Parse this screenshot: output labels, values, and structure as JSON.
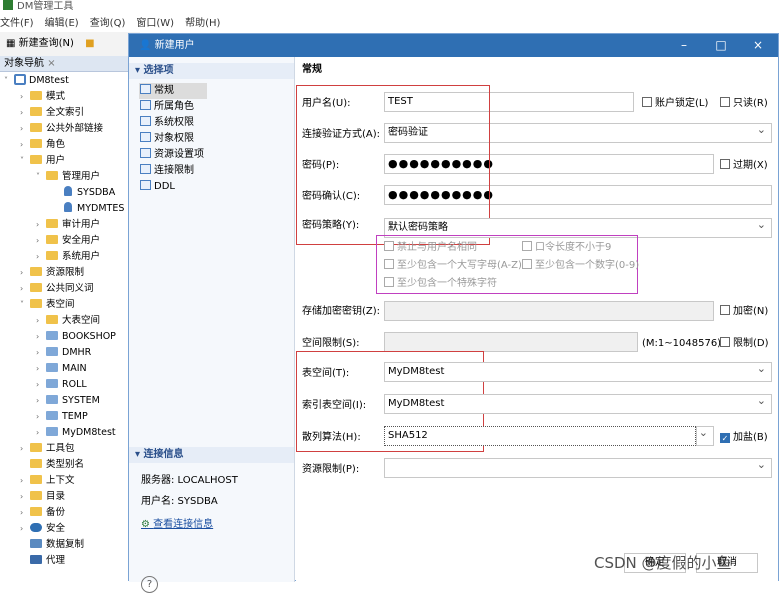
{
  "app": {
    "title": "DM管理工具"
  },
  "menu": [
    "文件(F)",
    "编辑(E)",
    "查询(Q)",
    "窗口(W)",
    "帮助(H)"
  ],
  "toolbar": {
    "new_query": "新建查询(N)"
  },
  "nav": {
    "title": "对象导航",
    "items": [
      "DM8test",
      "模式",
      "全文索引",
      "公共外部链接",
      "角色",
      "用户",
      "管理用户",
      "SYSDBA",
      "MYDMTES",
      "审计用户",
      "安全用户",
      "系统用户",
      "资源限制",
      "公共同义词",
      "表空间",
      "大表空间",
      "BOOKSHOP",
      "DMHR",
      "MAIN",
      "ROLL",
      "SYSTEM",
      "TEMP",
      "MyDM8test",
      "工具包",
      "类型别名",
      "上下文",
      "目录",
      "备份",
      "安全",
      "数据复制",
      "代理"
    ]
  },
  "dialog": {
    "title": "新建用户",
    "select_section": "选择项",
    "pages": [
      "常规",
      "所属角色",
      "系统权限",
      "对象权限",
      "资源设置项",
      "连接限制",
      "DDL"
    ],
    "conn_section": "连接信息",
    "server": "服务器: LOCALHOST",
    "user": "用户名: SYSDBA",
    "view_conn": "查看连接信息",
    "section": "常规",
    "labels": {
      "username": "用户名(U):",
      "auth": "连接验证方式(A):",
      "password": "密码(P):",
      "confirm": "密码确认(C):",
      "policy": "密码策略(Y):",
      "storekey": "存储加密密钥(Z):",
      "space": "空间限制(S):",
      "tablespace": "表空间(T):",
      "idxspace": "索引表空间(I):",
      "hash": "散列算法(H):",
      "reslimit": "资源限制(P):"
    },
    "values": {
      "username": "TEST",
      "auth": "密码验证",
      "password": "●●●●●●●●●●",
      "confirm": "●●●●●●●●●●",
      "policy": "默认密码策略",
      "space_hint": "(M:1~1048576)",
      "tablespace": "MyDM8test",
      "idxspace": "MyDM8test",
      "hash": "SHA512"
    },
    "checks": {
      "lock": "账户锁定(L)",
      "readonly": "只读(R)",
      "expire": "过期(X)",
      "encrypt": "加密(N)",
      "limit": "限制(D)",
      "salt": "加盐(B)"
    },
    "policy_opts": [
      "禁止与用户名相同",
      "口令长度不小于9",
      "至少包含一个大写字母(A-Z)",
      "至少包含一个数字(0-9)",
      "至少包含一个特殊字符"
    ],
    "help": "?",
    "ok": "确定",
    "cancel": "取消"
  },
  "watermark": "CSDN @度假的小鱼"
}
